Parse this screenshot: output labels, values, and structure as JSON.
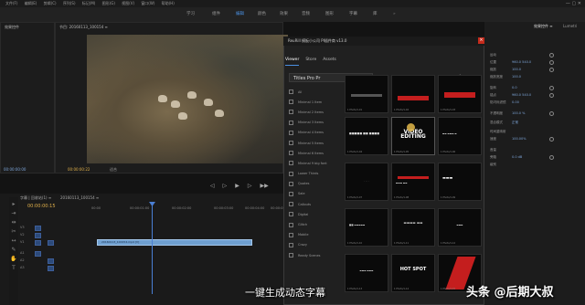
{
  "menubar": {
    "items": [
      "文件(F)",
      "编辑(E)",
      "剪辑(C)",
      "序列(S)",
      "标记(M)",
      "图形(G)",
      "视图(V)",
      "窗口(W)",
      "帮助(H)"
    ]
  },
  "workspaces": {
    "items": [
      "学习",
      "组件",
      "编辑",
      "颜色",
      "效果",
      "音频",
      "图形",
      "字幕",
      "库"
    ],
    "active": "编辑",
    "more": "»"
  },
  "source_panel": {
    "tab": "效果控件"
  },
  "program_panel": {
    "tab": "节目: 20160113_100154 ≡"
  },
  "program_timecode": "00:00:00:00",
  "program_timecode2": "00:00:00:22",
  "program_fit": "适合",
  "transport": [
    "◁",
    "▷",
    "▶",
    "▷",
    "▶▶"
  ],
  "timeline": {
    "tab": "字幕 | 回收站(1) ≡",
    "tab2": "20160113_100154 ≡",
    "time": "00:00:00:15",
    "ruler": [
      "00:00",
      "00:00:01:00",
      "00:00:02:00",
      "00:00:03:00",
      "00:00:04:00",
      "00:00:05:00"
    ],
    "clip_label": "20160113_100154.mp4 [V]",
    "tracks": [
      "V3",
      "V2",
      "V1",
      "A1",
      "A2",
      "A3"
    ]
  },
  "plugin": {
    "title": "ReuRill 模板小公司 PI插件商 v13.0",
    "close": "×",
    "tabs": [
      "Viewer",
      "Store",
      "Assets"
    ],
    "active_tab": "Viewer",
    "pack": "Titles Pro Pr",
    "star": "★",
    "more": "···",
    "categories": [
      "All",
      "Minimal 1 Item",
      "Minimal 2 Items",
      "Minimal 3 Items",
      "Minimal 4 Items",
      "Minimal 5 Items",
      "Minimal 6 Items",
      "Minimal 9 big font",
      "Lower Thirds",
      "Quotes",
      "Sale",
      "Callouts",
      "Digital",
      "Glitch",
      "Mobile",
      "Crazy",
      "Ready Scenes"
    ],
    "thumbs": [
      {
        "text": "",
        "caption": "1 Photo/1-01"
      },
      {
        "text": "",
        "caption": "1 Photo/1-02"
      },
      {
        "text": "",
        "caption": "1 Photo/1-03"
      },
      {
        "text": "",
        "caption": "1 Photo/1-04"
      },
      {
        "text": "VIDEO EDITING",
        "caption": "1 Photo/1-05"
      },
      {
        "text": "",
        "caption": "1 Photo/1-06"
      },
      {
        "text": "",
        "caption": "1 Photo/1-07"
      },
      {
        "text": "",
        "caption": "1 Photo/1-08"
      },
      {
        "text": "",
        "caption": "1 Photo/1-09"
      },
      {
        "text": "",
        "caption": "1 Photo/1-10"
      },
      {
        "text": "",
        "caption": "1 Photo/1-11"
      },
      {
        "text": "",
        "caption": "1 Photo/1-12"
      },
      {
        "text": "",
        "caption": "1 Photo/1-13"
      },
      {
        "text": "HOT SPOT",
        "caption": "1 Photo/1-14"
      },
      {
        "text": "",
        "caption": "1 Photo/1-15"
      }
    ]
  },
  "right_panel": {
    "tab1": "效果控件 ≡",
    "tab2": "Lumetri",
    "rows": [
      "运动",
      "位置",
      "缩放",
      "缩放宽度",
      "旋转",
      "锚点",
      "防闪烁滤镜",
      "不透明度",
      "混合模式",
      "时间重映射",
      "速度",
      "音量",
      "旁路",
      "级别"
    ],
    "values": [
      "960.0  540.0",
      "100.0",
      "100.0",
      "0.0",
      "960.0  540.0",
      "0.00",
      "100.0 %",
      "正常",
      "100.00%",
      "0.0 dB"
    ]
  },
  "caption": "一键生成动态字幕",
  "watermark": "头条 @后期大叔",
  "colors": {
    "accent": "#4a90e2",
    "clip": "#6f9fcf",
    "timecode": "#e0b04a",
    "close": "#c42b1c",
    "red_bar": "#c41e1e"
  }
}
